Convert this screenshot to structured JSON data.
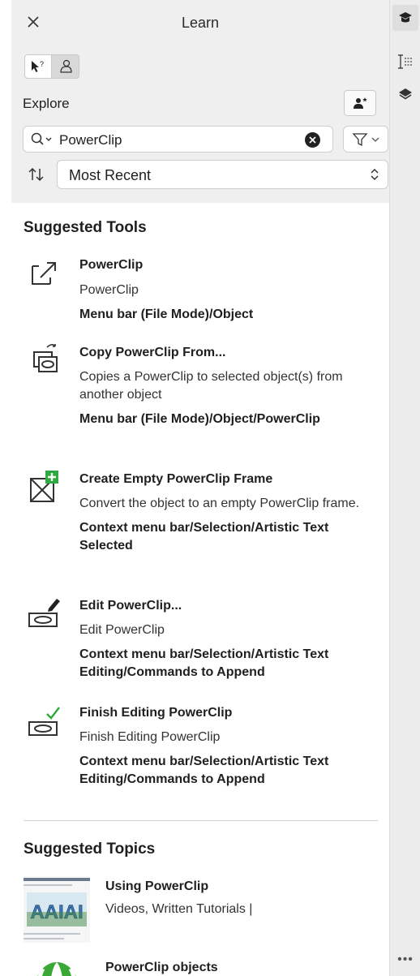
{
  "panel": {
    "title": "Learn",
    "explore_label": "Explore"
  },
  "search": {
    "value": "PowerClip"
  },
  "sort": {
    "value": "Most Recent"
  },
  "suggested_tools": {
    "heading": "Suggested Tools",
    "items": [
      {
        "name": "PowerClip",
        "desc": "PowerClip",
        "path": "Menu bar (File Mode)/Object",
        "icon": "powerclip-icon"
      },
      {
        "name": "Copy PowerClip From...",
        "desc": "Copies a PowerClip to selected object(s) from another object",
        "path": "Menu bar (File Mode)/Object/PowerClip",
        "icon": "copy-powerclip-icon"
      },
      {
        "name": "Create Empty PowerClip Frame",
        "desc": "Convert the object to an empty PowerClip frame.",
        "path": "Context menu bar/Selection/Artistic Text Selected",
        "icon": "empty-frame-icon"
      },
      {
        "name": "Edit PowerClip...",
        "desc": "Edit PowerClip",
        "path": "Context menu bar/Selection/Artistic Text Editing/Commands to Append",
        "icon": "edit-powerclip-icon"
      },
      {
        "name": "Finish Editing PowerClip",
        "desc": "Finish Editing PowerClip",
        "path": "Context menu bar/Selection/Artistic Text Editing/Commands to Append",
        "icon": "finish-editing-icon"
      }
    ]
  },
  "suggested_topics": {
    "heading": "Suggested Topics",
    "items": [
      {
        "title": "Using PowerClip",
        "sub": "Videos, Written Tutorials |"
      },
      {
        "title": "PowerClip objects",
        "sub": ""
      }
    ]
  },
  "colors": {
    "header_bg": "#efefef",
    "rail_bg": "#ececec",
    "accent_green": "#2eaa3c"
  }
}
